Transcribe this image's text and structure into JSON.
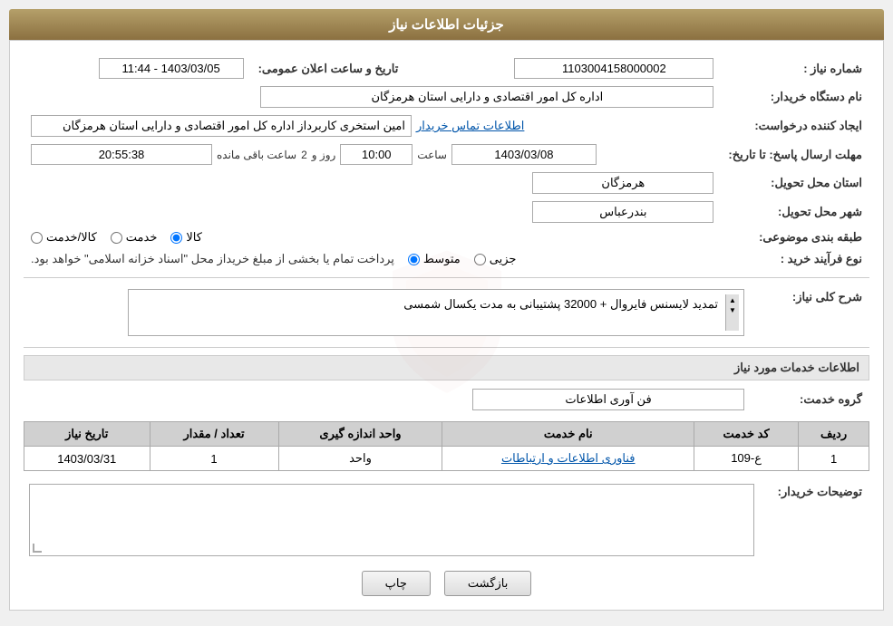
{
  "header": {
    "title": "جزئیات اطلاعات نیاز"
  },
  "fields": {
    "request_number_label": "شماره نیاز :",
    "request_number_value": "1103004158000002",
    "buyer_org_label": "نام دستگاه خریدار:",
    "buyer_org_value": "اداره کل امور اقتصادی و دارایی استان هرمزگان",
    "creator_label": "ایجاد کننده درخواست:",
    "creator_value": "امین استخری کاربرداز اداره کل امور اقتصادی و دارایی استان هرمزگان",
    "contact_link": "اطلاعات تماس خریدار",
    "announce_date_label": "تاریخ و ساعت اعلان عمومی:",
    "announce_date_value": "1403/03/05 - 11:44",
    "deadline_label": "مهلت ارسال پاسخ: تا تاریخ:",
    "deadline_date": "1403/03/08",
    "deadline_time_label": "ساعت",
    "deadline_time": "10:00",
    "deadline_day_label": "روز و",
    "deadline_days": "2",
    "deadline_remaining_label": "ساعت باقی مانده",
    "deadline_remaining": "20:55:38",
    "province_label": "استان محل تحویل:",
    "province_value": "هرمزگان",
    "city_label": "شهر محل تحویل:",
    "city_value": "بندرعباس",
    "category_label": "طبقه بندی موضوعی:",
    "category_options": [
      {
        "id": "kala",
        "label": "کالا"
      },
      {
        "id": "khedmat",
        "label": "خدمت"
      },
      {
        "id": "kala_khedmat",
        "label": "کالا/خدمت"
      }
    ],
    "category_selected": "kala",
    "process_label": "نوع فرآیند خرید :",
    "process_options": [
      {
        "id": "jozi",
        "label": "جزیی"
      },
      {
        "id": "motevasset",
        "label": "متوسط"
      }
    ],
    "process_selected": "motevasset",
    "process_note": "پرداخت تمام یا بخشی از مبلغ خریداز محل \"اسناد خزانه اسلامی\" خواهد بود.",
    "description_label": "شرح کلی نیاز:",
    "description_value": "تمدید لایسنس فایروال + 32000 پشتیبانی به مدت یکسال شمسی",
    "services_section_title": "اطلاعات خدمات مورد نیاز",
    "service_group_label": "گروه خدمت:",
    "service_group_value": "فن آوری اطلاعات",
    "services_table": {
      "headers": [
        "ردیف",
        "کد خدمت",
        "نام خدمت",
        "واحد اندازه گیری",
        "تعداد / مقدار",
        "تاریخ نیاز"
      ],
      "rows": [
        {
          "row": "1",
          "code": "ع-109",
          "name": "فناوری اطلاعات و ارتباطات",
          "unit": "واحد",
          "quantity": "1",
          "date": "1403/03/31"
        }
      ]
    },
    "buyer_desc_label": "توضیحات خریدار:",
    "buyer_desc_value": "",
    "btn_print": "چاپ",
    "btn_back": "بازگشت"
  }
}
